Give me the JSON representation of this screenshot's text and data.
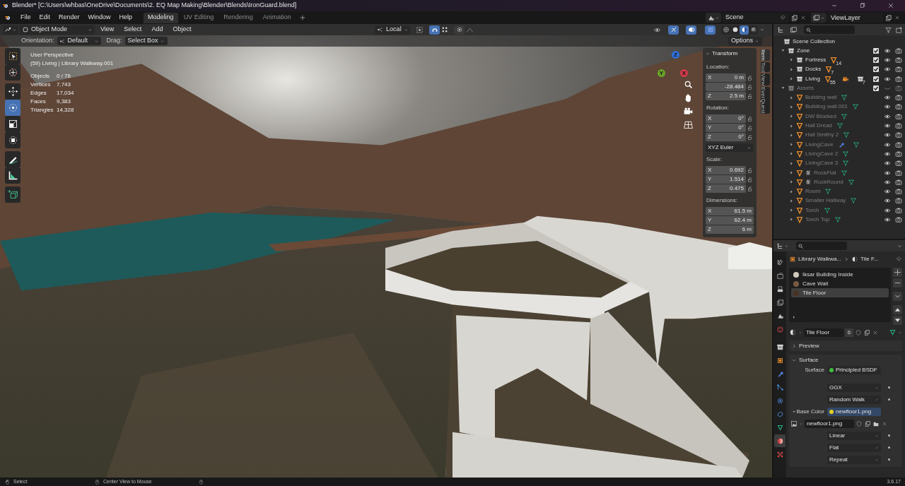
{
  "window": {
    "title": "Blender* [C:\\Users\\whbas\\OneDrive\\Documents\\2. EQ Map Making\\Blender\\Blends\\IronGuard.blend]"
  },
  "menu": [
    "File",
    "Edit",
    "Render",
    "Window",
    "Help"
  ],
  "workspaces": [
    {
      "label": "Modeling",
      "selected": true
    },
    {
      "label": "UV Editing",
      "selected": false
    },
    {
      "label": "Rendering",
      "selected": false
    },
    {
      "label": "Animation",
      "selected": false
    }
  ],
  "scene_field": "Scene",
  "view_layer_field": "ViewLayer",
  "viewport_header": {
    "mode": "Object Mode",
    "menus": [
      "View",
      "Select",
      "Add",
      "Object"
    ],
    "pivot": "Local",
    "toggles": [
      {
        "kind": "snap",
        "on": true
      },
      {
        "kind": "proportional",
        "on": false
      },
      {
        "kind": "gizmo",
        "on": true
      },
      {
        "kind": "overlay",
        "on": true
      },
      {
        "kind": "xray",
        "on": true
      }
    ],
    "shading": [
      {
        "kind": "wireframe",
        "selected": false
      },
      {
        "kind": "solid",
        "selected": false
      },
      {
        "kind": "material",
        "selected": true
      },
      {
        "kind": "rendered",
        "selected": false
      }
    ]
  },
  "tool_settings": {
    "orientation_label": "Orientation:",
    "orientation": "Default",
    "drag_label": "Drag:",
    "drag": "Select Box",
    "options": "Options"
  },
  "toolbar": [
    {
      "kind": "select-box",
      "selected": false
    },
    {
      "kind": "cursor",
      "selected": false
    },
    {
      "kind": "move",
      "selected": false
    },
    {
      "kind": "rotate",
      "selected": true
    },
    {
      "kind": "scale",
      "selected": false
    },
    {
      "kind": "transform",
      "selected": false
    },
    {
      "kind": "annotate",
      "selected": false
    },
    {
      "kind": "measure",
      "selected": false
    },
    {
      "kind": "add-cube",
      "selected": false
    }
  ],
  "viewport": {
    "title": "User Perspective",
    "subtitle": "(59) Living | Library Walkway.001",
    "stats": [
      {
        "label": "Objects",
        "value": "0 / 76"
      },
      {
        "label": "Vertices",
        "value": "7,743"
      },
      {
        "label": "Edges",
        "value": "17,034"
      },
      {
        "label": "Faces",
        "value": "9,383"
      },
      {
        "label": "Triangles",
        "value": "14,328"
      }
    ],
    "gizmo_axes": [
      {
        "label": "Z",
        "color": "#2f6fd6"
      },
      {
        "label": "Y",
        "color": "#6aa329"
      },
      {
        "label": "X",
        "color": "#d03a4a"
      }
    ]
  },
  "transform": {
    "title": "Transform",
    "rotation_mode": "XYZ Euler",
    "groups": [
      {
        "label": "Location:",
        "fields": [
          {
            "axis": "X",
            "value": "0 m",
            "locked": false
          },
          {
            "value": "-28.484",
            "locked": false
          },
          {
            "axis": "Z",
            "value": "2.5 m",
            "locked": false
          }
        ]
      },
      {
        "label": "Rotation:",
        "fields": [
          {
            "axis": "X",
            "value": "0°",
            "locked": false
          },
          {
            "axis": "Y",
            "value": "0°",
            "locked": false
          },
          {
            "axis": "Z",
            "value": "0°",
            "locked": false
          }
        ]
      },
      {
        "label": "Scale:",
        "fields": [
          {
            "axis": "X",
            "value": "0.692",
            "locked": false
          },
          {
            "axis": "Y",
            "value": "1.514",
            "locked": false
          },
          {
            "axis": "Z",
            "value": "0.475",
            "locked": false
          }
        ]
      },
      {
        "label": "Dimensions:",
        "fields": [
          {
            "axis": "X",
            "value": "61.5 m"
          },
          {
            "axis": "Y",
            "value": "62.4 m"
          },
          {
            "axis": "Z",
            "value": "6 m"
          }
        ]
      }
    ]
  },
  "side_tabs": [
    {
      "label": "Item",
      "selected": true
    },
    {
      "label": "Tool",
      "selected": false
    },
    {
      "label": "View",
      "selected": false
    },
    {
      "label": "EverQuest",
      "selected": false
    }
  ],
  "outliner": {
    "root": "Scene Collection",
    "items": [
      {
        "label": "Zone",
        "kind": "collection",
        "expanded": true,
        "checked": true,
        "disabled": false,
        "children": [
          {
            "label": "Fortress",
            "kind": "collection",
            "expanded": false,
            "checked": true,
            "disabled": false,
            "badges": [
              {
                "kind": "mesh",
                "count": "14"
              }
            ]
          },
          {
            "label": "Docks",
            "kind": "collection",
            "expanded": false,
            "checked": true,
            "disabled": false,
            "badges": [
              {
                "kind": "mesh",
                "count": "7"
              }
            ]
          },
          {
            "label": "Living",
            "kind": "collection",
            "expanded": false,
            "checked": true,
            "disabled": false,
            "badges": [
              {
                "kind": "mesh",
                "count": "55"
              },
              {
                "kind": "camera"
              },
              {
                "kind": "collection",
                "count": "7"
              }
            ]
          }
        ]
      },
      {
        "label": "Assets",
        "kind": "collection",
        "expanded": true,
        "checked": true,
        "disabled": true,
        "children": [
          {
            "label": "Building wall",
            "kind": "mesh",
            "expanded": false,
            "disabled": true,
            "badges": [
              {
                "kind": "mesh-data"
              }
            ]
          },
          {
            "label": "Building wall.001",
            "kind": "mesh",
            "expanded": false,
            "disabled": true,
            "badges": [
              {
                "kind": "mesh-data"
              }
            ]
          },
          {
            "label": "DW Blocked",
            "kind": "mesh",
            "expanded": false,
            "disabled": true,
            "badges": [
              {
                "kind": "mesh-data"
              }
            ]
          },
          {
            "label": "Hall Dread",
            "kind": "mesh",
            "expanded": false,
            "disabled": true,
            "badges": [
              {
                "kind": "mesh-data"
              }
            ]
          },
          {
            "label": "Hall Smithy 2",
            "kind": "mesh",
            "expanded": false,
            "disabled": true,
            "badges": [
              {
                "kind": "mesh-data"
              }
            ]
          },
          {
            "label": "LivingCave",
            "kind": "mesh",
            "expanded": false,
            "disabled": true,
            "badges": [
              {
                "kind": "modifier"
              },
              {
                "kind": "mesh-data"
              }
            ]
          },
          {
            "label": "LivingCave 2",
            "kind": "mesh",
            "expanded": false,
            "disabled": true,
            "badges": [
              {
                "kind": "mesh-data"
              }
            ]
          },
          {
            "label": "LivingCave 3",
            "kind": "mesh",
            "expanded": false,
            "disabled": true,
            "badges": [
              {
                "kind": "mesh-data"
              }
            ]
          },
          {
            "label": "RockFlat",
            "kind": "instanced",
            "expanded": false,
            "disabled": true,
            "badges": [
              {
                "kind": "mesh-data"
              }
            ]
          },
          {
            "label": "RockRound",
            "kind": "instanced",
            "expanded": false,
            "disabled": true,
            "badges": [
              {
                "kind": "mesh-data"
              }
            ]
          },
          {
            "label": "Room",
            "kind": "mesh",
            "expanded": false,
            "disabled": true,
            "badges": [
              {
                "kind": "mesh-data"
              }
            ]
          },
          {
            "label": "Smaller Hallway",
            "kind": "mesh",
            "expanded": false,
            "disabled": true,
            "badges": [
              {
                "kind": "mesh-data"
              }
            ]
          },
          {
            "label": "Torch",
            "kind": "mesh",
            "expanded": false,
            "disabled": true,
            "badges": [
              {
                "kind": "mesh-data"
              }
            ]
          },
          {
            "label": "Torch Top",
            "kind": "mesh",
            "expanded": false,
            "disabled": true,
            "badges": [
              {
                "kind": "mesh-data"
              }
            ]
          }
        ]
      }
    ]
  },
  "properties": {
    "tabs": [
      {
        "kind": "tool",
        "selected": false
      },
      {
        "kind": "render",
        "selected": false
      },
      {
        "kind": "output",
        "selected": false
      },
      {
        "kind": "view-layer",
        "selected": false
      },
      {
        "kind": "scene",
        "selected": false
      },
      {
        "kind": "world",
        "selected": false
      },
      {
        "kind": "collection",
        "selected": false
      },
      {
        "kind": "object",
        "selected": false
      },
      {
        "kind": "modifier",
        "selected": false
      },
      {
        "kind": "particles",
        "selected": false
      },
      {
        "kind": "physics",
        "selected": false
      },
      {
        "kind": "constraints",
        "selected": false
      },
      {
        "kind": "data",
        "selected": false
      },
      {
        "kind": "material",
        "selected": true
      },
      {
        "kind": "texture",
        "selected": false
      }
    ],
    "breadcrumb": [
      "Library Walkwa...",
      "Tile F..."
    ],
    "slots": [
      {
        "label": "Iksar Building Inside",
        "color": "#cfcabc",
        "selected": false
      },
      {
        "label": "Cave Wall",
        "color": "#7a5a44",
        "selected": false
      },
      {
        "label": "Tile Floor",
        "color": "#4a3222",
        "selected": true
      }
    ],
    "material_name": "Tile Floor",
    "material_users": "6",
    "panels": [
      {
        "label": "Preview",
        "expanded": false
      },
      {
        "label": "Surface",
        "expanded": true
      }
    ],
    "surface": {
      "label": "Surface",
      "shader": "Principled BSDF",
      "distribution": "GGX",
      "subsurface": "Random Walk",
      "base_color_label": "Base Color",
      "base_color": "newfloor1.png",
      "image": "newfloor1.png",
      "interpolation": "Linear",
      "projection": "Flat",
      "extension": "Repeat"
    }
  },
  "status_bar": {
    "items": [
      "Select",
      "Center View to Mouse"
    ],
    "version": "3.6.17"
  }
}
